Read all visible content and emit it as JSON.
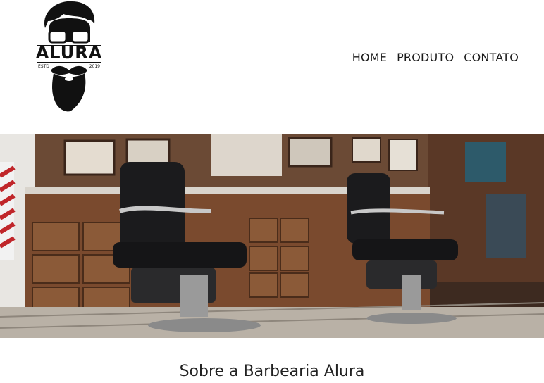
{
  "logo": {
    "name": "ALURA",
    "estd": "ESTD",
    "year": "2019"
  },
  "nav": {
    "items": [
      "HOME",
      "PRODUTO",
      "CONTATO"
    ]
  },
  "hero": {
    "image": "barbershop-interior"
  },
  "main": {
    "title": "Sobre a Barbearia Alura"
  }
}
